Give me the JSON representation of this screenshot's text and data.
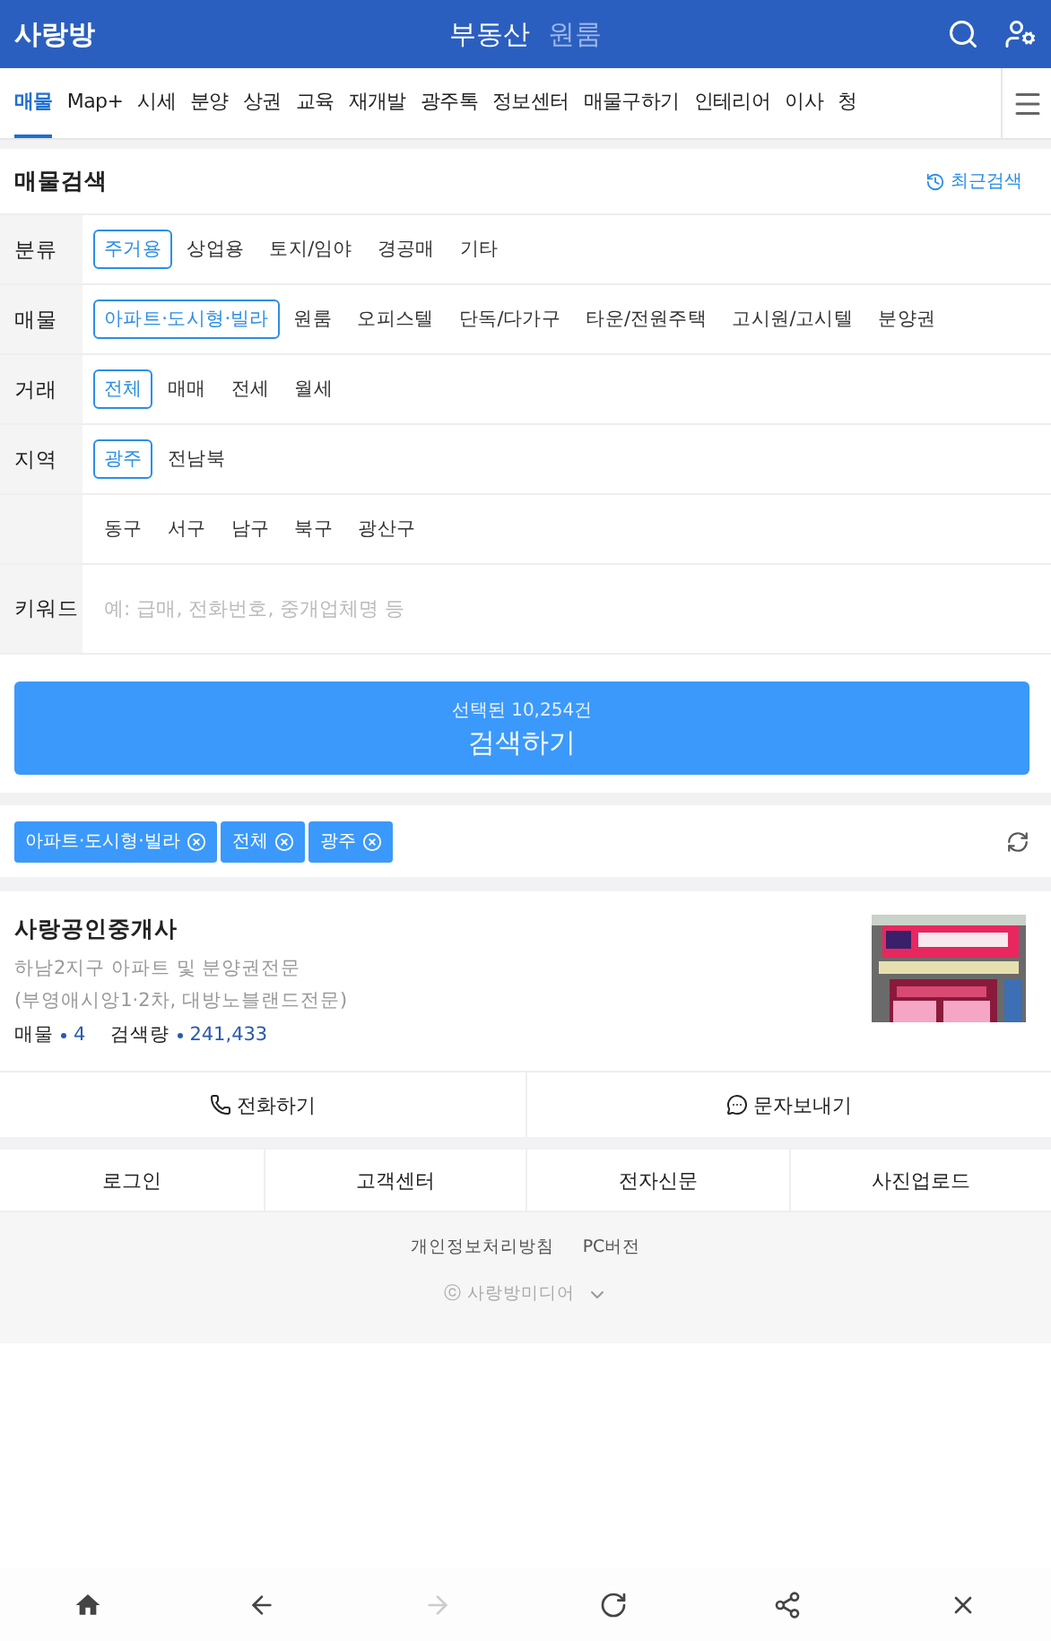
{
  "header": {
    "logo": "사랑방",
    "sections": [
      {
        "label": "부동산",
        "selected": true
      },
      {
        "label": "원룸",
        "selected": false
      }
    ]
  },
  "nav": [
    {
      "label": "매물",
      "selected": true
    },
    {
      "label": "Map+",
      "selected": false
    },
    {
      "label": "시세",
      "selected": false
    },
    {
      "label": "분양",
      "selected": false
    },
    {
      "label": "상권",
      "selected": false
    },
    {
      "label": "교육",
      "selected": false
    },
    {
      "label": "재개발",
      "selected": false
    },
    {
      "label": "광주톡",
      "selected": false
    },
    {
      "label": "정보센터",
      "selected": false
    },
    {
      "label": "매물구하기",
      "selected": false
    },
    {
      "label": "인테리어",
      "selected": false
    },
    {
      "label": "이사",
      "selected": false
    },
    {
      "label": "청",
      "selected": false
    }
  ],
  "search": {
    "title": "매물검색",
    "recent": "최근검색",
    "filters": [
      {
        "label": "분류",
        "options": [
          {
            "label": "주거용",
            "selected": true
          },
          {
            "label": "상업용",
            "selected": false
          },
          {
            "label": "토지/임야",
            "selected": false
          },
          {
            "label": "경공매",
            "selected": false
          },
          {
            "label": "기타",
            "selected": false
          }
        ]
      },
      {
        "label": "매물",
        "options": [
          {
            "label": "아파트·도시형·빌라",
            "selected": true
          },
          {
            "label": "원룸",
            "selected": false
          },
          {
            "label": "오피스텔",
            "selected": false
          },
          {
            "label": "단독/다가구",
            "selected": false
          },
          {
            "label": "타운/전원주택",
            "selected": false
          },
          {
            "label": "고시원/고시텔",
            "selected": false
          },
          {
            "label": "분양권",
            "selected": false
          }
        ]
      },
      {
        "label": "거래",
        "options": [
          {
            "label": "전체",
            "selected": true
          },
          {
            "label": "매매",
            "selected": false
          },
          {
            "label": "전세",
            "selected": false
          },
          {
            "label": "월세",
            "selected": false
          }
        ]
      },
      {
        "label": "지역",
        "options": [
          {
            "label": "광주",
            "selected": true
          },
          {
            "label": "전남북",
            "selected": false
          }
        ]
      },
      {
        "options": [
          {
            "label": "동구",
            "selected": false
          },
          {
            "label": "서구",
            "selected": false
          },
          {
            "label": "남구",
            "selected": false
          },
          {
            "label": "북구",
            "selected": false
          },
          {
            "label": "광산구",
            "selected": false
          }
        ]
      }
    ],
    "keyword": {
      "label": "키워드",
      "placeholder": "예: 급매, 전화번호, 중개업체명 등"
    },
    "submit": {
      "count": "선택된 10,254건",
      "label": "검색하기"
    }
  },
  "chips": [
    "아파트·도시형·빌라",
    "전체",
    "광주"
  ],
  "agent": {
    "name": "사랑공인중개사",
    "description": [
      "하남2지구 아파트 및 분양권전문",
      "(부영애시앙1·2차, 대방노블랜드전문)"
    ],
    "stats": [
      {
        "label": "매물",
        "value": "4"
      },
      {
        "label": "검색량",
        "value": "241,433"
      }
    ],
    "actions": [
      {
        "kind": "call",
        "label": "전화하기"
      },
      {
        "kind": "sms",
        "label": "문자보내기"
      }
    ]
  },
  "footer": {
    "links": [
      "로그인",
      "고객센터",
      "전자신문",
      "사진업로드"
    ],
    "policy": [
      "개인정보처리방침",
      "PC버전"
    ],
    "copyright": "ⓒ 사랑방미디어"
  },
  "bottom_bar": [
    {
      "kind": "home",
      "disabled": false
    },
    {
      "kind": "back",
      "disabled": false
    },
    {
      "kind": "forward",
      "disabled": true
    },
    {
      "kind": "reload",
      "disabled": false
    },
    {
      "kind": "share",
      "disabled": false
    },
    {
      "kind": "close",
      "disabled": false
    }
  ]
}
